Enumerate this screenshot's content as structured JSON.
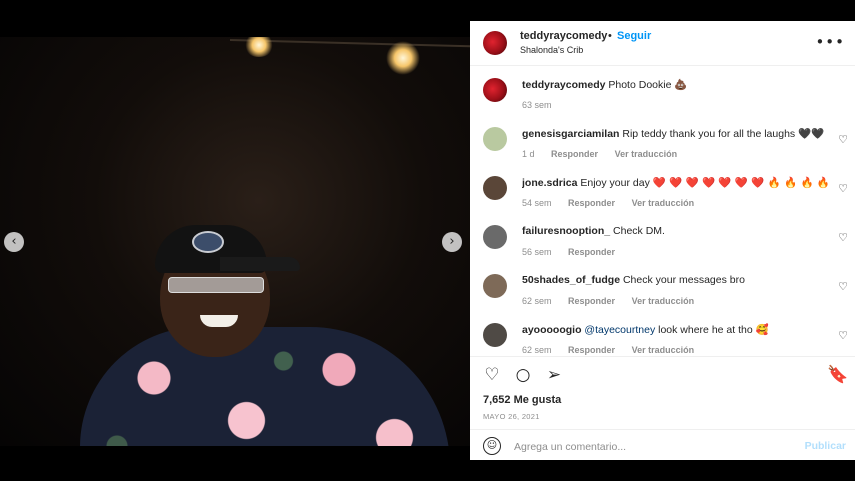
{
  "post": {
    "author": "teddyraycomedy",
    "follow_label": "Seguir",
    "separator": "•",
    "location": "Shalonda's Crib",
    "more_label": "•••",
    "caption_author": "teddyraycomedy",
    "caption_text": "Photo Dookie",
    "caption_emoji": "💩",
    "caption_time": "63 sem"
  },
  "carousel": {
    "prev_label": "‹",
    "next_label": "›"
  },
  "comments": [
    {
      "user": "genesisgarciamilan",
      "text": "Rip teddy thank you for all the laughs ",
      "emoji": "🖤🖤",
      "time": "1 d",
      "reply": "Responder",
      "translate": "Ver traducción",
      "avatar": "#b9c9a0"
    },
    {
      "user": "jone.sdrica",
      "text": "Enjoy your day ",
      "emoji": "❤️ ❤️ ❤️ ❤️ ❤️ ❤️ ❤️ 🔥 🔥 🔥 🔥",
      "time": "54 sem",
      "reply": "Responder",
      "translate": "Ver traducción",
      "avatar": "#5a4638"
    },
    {
      "user": "failuresnooption_",
      "text": "Check DM.",
      "emoji": "",
      "time": "56 sem",
      "reply": "Responder",
      "translate": "",
      "avatar": "#6a6a6a"
    },
    {
      "user": "50shades_of_fudge",
      "text": "Check your messages bro",
      "emoji": "",
      "time": "62 sem",
      "reply": "Responder",
      "translate": "Ver traducción",
      "avatar": "#7e6a58"
    },
    {
      "user": "ayooooogio",
      "mention": "@tayecourtney",
      "text": " look where he at tho ",
      "emoji": "🥰",
      "time": "62 sem",
      "reply": "Responder",
      "translate": "Ver traducción",
      "avatar": "#4f4a45"
    }
  ],
  "actions": {
    "like_icon": "♡",
    "comment_icon": "○",
    "share_icon": "➢",
    "save_icon": "🔖",
    "likes_label": "7,652 Me gusta",
    "date": "MAYO 26, 2021"
  },
  "composer": {
    "emoji_icon": "☺",
    "placeholder": "Agrega un comentario...",
    "publish_label": "Publicar"
  },
  "heart_icon": "♡"
}
